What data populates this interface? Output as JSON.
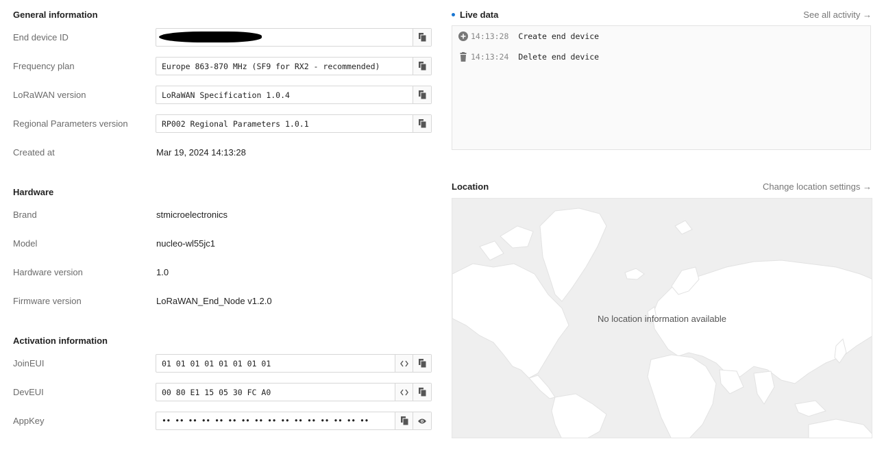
{
  "general": {
    "title": "General information",
    "rows": [
      {
        "label": "End device ID",
        "value": ""
      },
      {
        "label": "Frequency plan",
        "value": "Europe 863-870 MHz (SF9 for RX2 - recommended)"
      },
      {
        "label": "LoRaWAN version",
        "value": "LoRaWAN Specification 1.0.4"
      },
      {
        "label": "Regional Parameters version",
        "value": "RP002 Regional Parameters 1.0.1"
      },
      {
        "label": "Created at",
        "value": "Mar 19, 2024 14:13:28"
      }
    ]
  },
  "hardware": {
    "title": "Hardware",
    "rows": [
      {
        "label": "Brand",
        "value": "stmicroelectronics"
      },
      {
        "label": "Model",
        "value": "nucleo-wl55jc1"
      },
      {
        "label": "Hardware version",
        "value": "1.0"
      },
      {
        "label": "Firmware version",
        "value": "LoRaWAN_End_Node v1.2.0"
      }
    ]
  },
  "activation": {
    "title": "Activation information",
    "rows": [
      {
        "label": "JoinEUI",
        "value": "01 01 01 01 01 01 01 01"
      },
      {
        "label": "DevEUI",
        "value": "00 80 E1 15 05 30 FC A0"
      },
      {
        "label": "AppKey",
        "value": "•• •• •• •• •• •• •• •• •• •• •• •• •• •• •• ••"
      }
    ]
  },
  "live": {
    "title": "Live data",
    "link": "See all activity →",
    "events": [
      {
        "icon": "add-circle-icon",
        "time": "14:13:28",
        "text": "Create end device"
      },
      {
        "icon": "trash-icon",
        "time": "14:13:24",
        "text": "Delete end device"
      }
    ]
  },
  "location": {
    "title": "Location",
    "link": "Change location settings →",
    "message": "No location information available"
  },
  "colors": {
    "accent": "#1976d2",
    "map_bg": "#efefef",
    "land": "#ffffff"
  }
}
